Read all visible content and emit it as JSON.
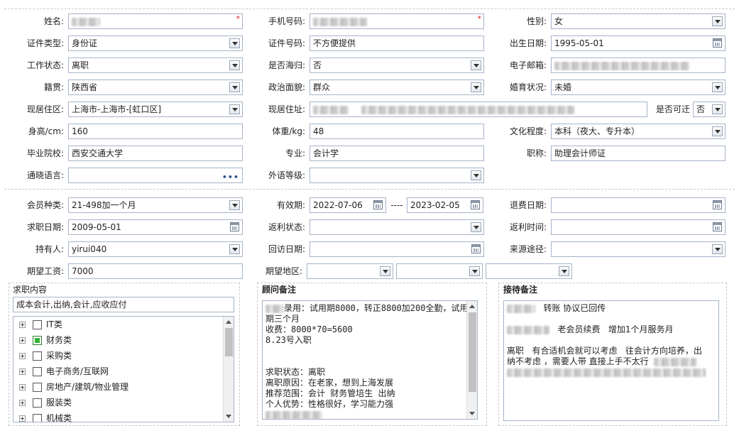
{
  "fields": {
    "name": {
      "label": "姓名:"
    },
    "phone": {
      "label": "手机号码:"
    },
    "gender": {
      "label": "性别:",
      "value": "女"
    },
    "id_type": {
      "label": "证件类型:",
      "value": "身份证"
    },
    "id_number": {
      "label": "证件号码:",
      "value": "不方便提供"
    },
    "birth_date": {
      "label": "出生日期:",
      "value": "1995-05-01"
    },
    "work_status": {
      "label": "工作状态:",
      "value": "离职"
    },
    "returnee": {
      "label": "是否海归:",
      "value": "否"
    },
    "email": {
      "label": "电子邮箱:"
    },
    "native_place": {
      "label": "籍贯:",
      "value": "陕西省"
    },
    "political": {
      "label": "政治面貌:",
      "value": "群众"
    },
    "marital": {
      "label": "婚育状况:",
      "value": "未婚"
    },
    "residence_area": {
      "label": "现居住区:",
      "value": "上海市-上海市-[虹口区]"
    },
    "address": {
      "label": "现居住址:"
    },
    "relocate": {
      "label": "是否可迁",
      "value": "否"
    },
    "height": {
      "label": "身高/cm:",
      "value": "160"
    },
    "weight": {
      "label": "体重/kg:",
      "value": "48"
    },
    "education": {
      "label": "文化程度:",
      "value": "本科（夜大、专升本）"
    },
    "school": {
      "label": "毕业院校:",
      "value": "西安交通大学"
    },
    "major": {
      "label": "专业:",
      "value": "会计学"
    },
    "title": {
      "label": "职称:",
      "value": "助理会计师证"
    },
    "language": {
      "label": "通晓语言:"
    },
    "foreign_level": {
      "label": "外语等级:"
    },
    "member_type": {
      "label": "会员种类:",
      "value": "21-498加一个月"
    },
    "validity": {
      "label": "有效期:",
      "from": "2022-07-06",
      "sep": "----",
      "to": "2023-02-05"
    },
    "refund_date": {
      "label": "退费日期:"
    },
    "job_date": {
      "label": "求职日期:",
      "value": "2009-05-01"
    },
    "rebate_status": {
      "label": "返利状态:"
    },
    "rebate_time": {
      "label": "返利时间:"
    },
    "holder": {
      "label": "持有人:",
      "value": "yirui040"
    },
    "revisit_date": {
      "label": "回访日期:"
    },
    "source": {
      "label": "来源途径:"
    },
    "expected_salary": {
      "label": "期望工资:",
      "value": "7000"
    },
    "expected_area": {
      "label": "期望地区:"
    }
  },
  "job_content": {
    "title": "求职内容",
    "summary": "成本会计,出纳,会计,应收应付",
    "items": [
      {
        "label": "IT类",
        "checked": false
      },
      {
        "label": "财务类",
        "checked": true
      },
      {
        "label": "采购类",
        "checked": false
      },
      {
        "label": "电子商务/互联网",
        "checked": false
      },
      {
        "label": "房地产/建筑/物业管理",
        "checked": false
      },
      {
        "label": "服装类",
        "checked": false
      },
      {
        "label": "机械类",
        "checked": false
      }
    ]
  },
  "advisor_notes": {
    "title": "顾问备注",
    "lines": [
      "录用：试用期8000，转正8800加200全勤，试用",
      "期三个月",
      "收费：8000*70=5600",
      "8.23号入职",
      "",
      "",
      "求职状态：离职",
      "离职原因：在老家，想到上海发展",
      "推荐范围：会计 财务管培生 出纳",
      "个人优势：性格很好，学习能力强"
    ]
  },
  "reception_notes": {
    "title": "接待备注",
    "lines": [
      "转账 协议已回传",
      "",
      "老会员续费   增加1个月服务月",
      "",
      "离职   有合适机会就可以考虑   往会计方向培养，出",
      "纳不考虑 ，需要人带 直接上手不太行"
    ]
  }
}
